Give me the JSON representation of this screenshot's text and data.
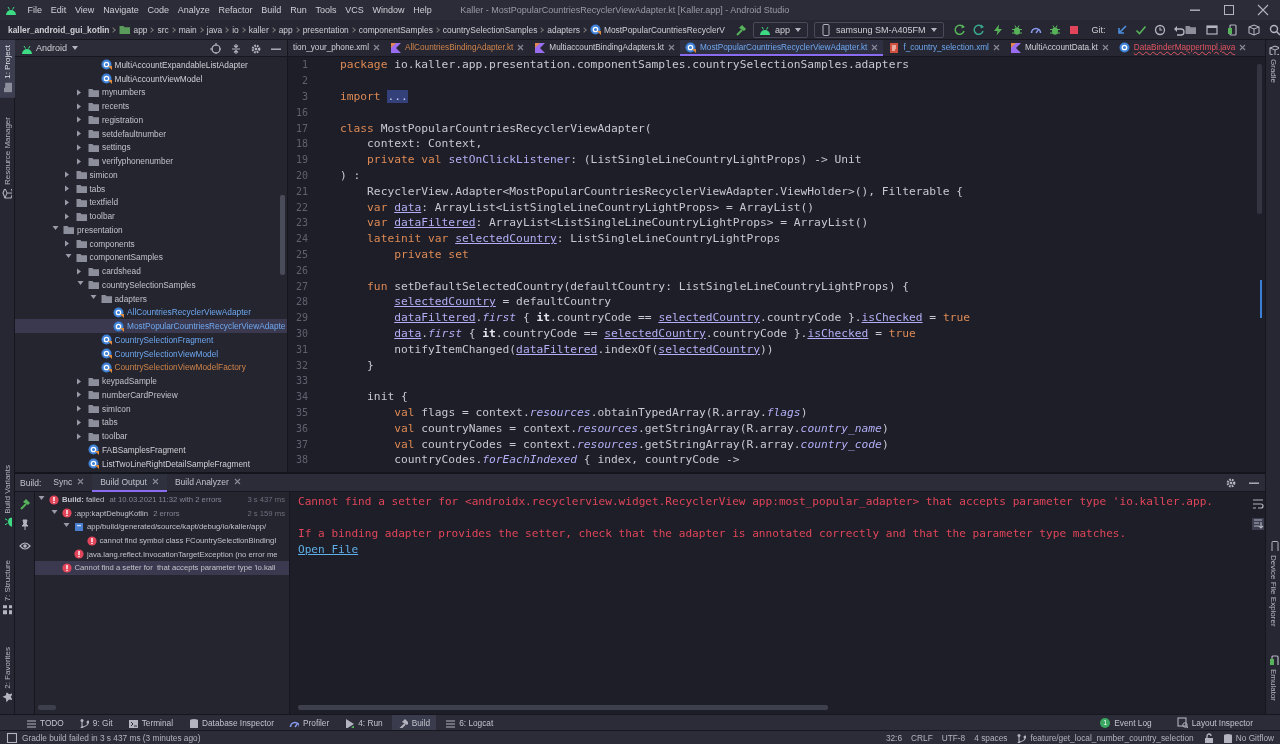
{
  "menu_bar": {
    "items": [
      "File",
      "Edit",
      "View",
      "Navigate",
      "Code",
      "Analyze",
      "Refactor",
      "Build",
      "Run",
      "Tools",
      "VCS",
      "Window",
      "Help"
    ],
    "title": "Kaller - MostPopularCountriesRecyclerViewAdapter.kt [Kaller.app] - Android Studio"
  },
  "nav_bar": {
    "breadcrumbs": [
      {
        "label": "kaller_android_gui_kotlin",
        "kind": "project"
      },
      {
        "label": "app",
        "kind": "module"
      },
      {
        "label": "src",
        "kind": "folder"
      },
      {
        "label": "main",
        "kind": "folder"
      },
      {
        "label": "java",
        "kind": "folder"
      },
      {
        "label": "io",
        "kind": "folder"
      },
      {
        "label": "kaller",
        "kind": "folder"
      },
      {
        "label": "app",
        "kind": "folder"
      },
      {
        "label": "presentation",
        "kind": "folder"
      },
      {
        "label": "componentSamples",
        "kind": "folder"
      },
      {
        "label": "countrySelectionSamples",
        "kind": "folder"
      },
      {
        "label": "adapters",
        "kind": "folder"
      },
      {
        "label": "MostPopularCountriesRecyclerV",
        "kind": "class"
      }
    ],
    "run_config": "app",
    "device": "samsung SM-A405FM",
    "git_label": "Git:"
  },
  "left_strip": {
    "top": [
      {
        "label": "1: Project",
        "selected": true
      },
      {
        "label": "Resource Manager",
        "selected": false
      }
    ],
    "bottom": [
      {
        "label": "Build Variants",
        "selected": false
      },
      {
        "label": "7: Structure",
        "selected": false
      },
      {
        "label": "2: Favorites",
        "selected": false
      }
    ]
  },
  "right_strip": {
    "top": [
      "Gradle"
    ],
    "bottom": [
      "Device File Explorer",
      "Emulator"
    ]
  },
  "project_panel": {
    "view": "Android",
    "tree": [
      {
        "kind": "continuation",
        "children": [
          {
            "kind": "continuation",
            "children": [
              {
                "kind": "continuation",
                "children": [
                  {
                    "kind": "class",
                    "label": "MultiAccountExpandableListAdapter",
                    "modified": false,
                    "unversioned": false,
                    "selected": false
                  },
                  {
                    "kind": "class",
                    "label": "MultiAccountViewModel",
                    "modified": false,
                    "unversioned": false,
                    "selected": false
                  }
                ]
              },
              {
                "kind": "folder",
                "label": "mynumbers",
                "expanded": false,
                "selected": false
              },
              {
                "kind": "folder",
                "label": "recents",
                "expanded": false,
                "selected": false
              },
              {
                "kind": "folder",
                "label": "registration",
                "expanded": false,
                "selected": false
              },
              {
                "kind": "folder",
                "label": "setdefaultnumber",
                "expanded": false,
                "selected": false
              },
              {
                "kind": "folder",
                "label": "settings",
                "expanded": false,
                "selected": false
              },
              {
                "kind": "folder",
                "label": "verifyphonenumber",
                "expanded": false,
                "selected": false
              }
            ]
          },
          {
            "kind": "folder",
            "label": "simicon",
            "expanded": false,
            "selected": false
          },
          {
            "kind": "folder",
            "label": "tabs",
            "expanded": false,
            "selected": false
          },
          {
            "kind": "folder",
            "label": "textfield",
            "expanded": false,
            "selected": false
          },
          {
            "kind": "folder",
            "label": "toolbar",
            "expanded": false,
            "selected": false
          }
        ]
      },
      {
        "kind": "folder",
        "label": "presentation",
        "expanded": true,
        "selected": false,
        "children": [
          {
            "kind": "folder",
            "label": "components",
            "expanded": false,
            "selected": false
          },
          {
            "kind": "folder",
            "label": "componentSamples",
            "expanded": true,
            "selected": false,
            "children": [
              {
                "kind": "folder",
                "label": "cardshead",
                "expanded": false,
                "selected": false
              },
              {
                "kind": "folder",
                "label": "countrySelectionSamples",
                "expanded": true,
                "selected": false,
                "children": [
                  {
                    "kind": "folder",
                    "label": "adapters",
                    "expanded": true,
                    "selected": false,
                    "children": [
                      {
                        "kind": "class",
                        "label": "AllCountriesRecyclerViewAdapter",
                        "modified": true,
                        "unversioned": false,
                        "selected": false
                      },
                      {
                        "kind": "class",
                        "label": "MostPopularCountriesRecyclerViewAdapte",
                        "modified": true,
                        "unversioned": false,
                        "selected": true
                      }
                    ]
                  },
                  {
                    "kind": "class",
                    "label": "CountrySelectionFragment",
                    "modified": true,
                    "unversioned": false,
                    "selected": false
                  },
                  {
                    "kind": "class",
                    "label": "CountrySelectionViewModel",
                    "modified": true,
                    "unversioned": false,
                    "selected": false
                  },
                  {
                    "kind": "class",
                    "label": "CountrySelectionViewModelFactory",
                    "modified": false,
                    "unversioned": true,
                    "selected": false
                  }
                ]
              },
              {
                "kind": "folder",
                "label": "keypadSample",
                "expanded": false,
                "selected": false
              },
              {
                "kind": "folder",
                "label": "numberCardPreview",
                "expanded": false,
                "selected": false
              },
              {
                "kind": "folder",
                "label": "simIcon",
                "expanded": false,
                "selected": false
              },
              {
                "kind": "folder",
                "label": "tabs",
                "expanded": false,
                "selected": false
              },
              {
                "kind": "folder",
                "label": "toolbar",
                "expanded": false,
                "selected": false
              },
              {
                "kind": "class",
                "label": "FABSamplesFragment",
                "modified": false,
                "unversioned": false,
                "selected": false
              },
              {
                "kind": "class",
                "label": "ListTwoLineRightDetailSampleFragment",
                "modified": false,
                "unversioned": false,
                "selected": false
              }
            ]
          }
        ]
      }
    ]
  },
  "editor": {
    "tabs": [
      {
        "label": "tion_your_phone.xml",
        "modified": false,
        "unversioned": false,
        "error": false,
        "selected": false
      },
      {
        "label": "AllCountriesBindingAdapter.kt",
        "kind": "kotlin",
        "modified": false,
        "unversioned": true,
        "error": false,
        "selected": false
      },
      {
        "label": "MultiaccountBindingAdapters.kt",
        "kind": "kotlin",
        "modified": false,
        "unversioned": false,
        "error": false,
        "selected": false
      },
      {
        "label": "MostPopularCountriesRecyclerViewAdapter.kt",
        "kind": "class",
        "modified": true,
        "unversioned": false,
        "error": false,
        "selected": true
      },
      {
        "label": "f_country_selection.xml",
        "kind": "xml",
        "modified": true,
        "unversioned": false,
        "error": false,
        "selected": false
      },
      {
        "label": "MultiAccountData.kt",
        "kind": "kotlin",
        "modified": false,
        "unversioned": false,
        "error": false,
        "selected": false
      },
      {
        "label": "DataBinderMapperImpl.java",
        "kind": "java",
        "modified": false,
        "unversioned": false,
        "error": true,
        "selected": false
      }
    ],
    "lines": [
      {
        "number": "1",
        "segments": [
          {
            "text": "package",
            "kind": "keyword"
          },
          {
            "text": " io.kaller.app.presentation.componentSamples.countrySelectionSamples.adapters",
            "kind": "plain"
          }
        ]
      },
      {
        "number": "2"
      },
      {
        "number": "3",
        "segments": [
          {
            "text": "import ",
            "kind": "keyword"
          },
          {
            "text": "...",
            "kind": "folded"
          }
        ]
      },
      {
        "number": "16"
      },
      {
        "number": "17",
        "segments": [
          {
            "text": "class",
            "kind": "keyword"
          },
          {
            "text": " MostPopularCountriesRecyclerViewAdapter(",
            "kind": "plain"
          }
        ]
      },
      {
        "number": "18",
        "segments": [
          {
            "text": "    context: Context,",
            "kind": "plain"
          }
        ]
      },
      {
        "number": "19",
        "segments": [
          {
            "text": "    private val ",
            "kind": "keyword"
          },
          {
            "text": "setOnClickListener",
            "kind": "property"
          },
          {
            "text": ": (ListSingleLineCountryLightProps) -> Unit",
            "kind": "plain"
          }
        ]
      },
      {
        "number": "20",
        "segments": [
          {
            "text": ") :",
            "kind": "plain"
          }
        ]
      },
      {
        "number": "21",
        "segments": [
          {
            "text": "    RecyclerView.Adapter<MostPopularCountriesRecyclerViewAdapter.ViewHolder>(), Filterable {",
            "kind": "plain"
          }
        ]
      },
      {
        "number": "22",
        "segments": [
          {
            "text": "    var ",
            "kind": "keyword"
          },
          {
            "text": "data",
            "kind": "field"
          },
          {
            "text": ": ArrayList<ListSingleLineCountryLightProps> = ArrayList()",
            "kind": "plain"
          }
        ]
      },
      {
        "number": "23",
        "segments": [
          {
            "text": "    var ",
            "kind": "keyword"
          },
          {
            "text": "dataFiltered",
            "kind": "field"
          },
          {
            "text": ": ArrayList<ListSingleLineCountryLightProps> = ArrayList()",
            "kind": "plain"
          }
        ]
      },
      {
        "number": "24",
        "segments": [
          {
            "text": "    lateinit var ",
            "kind": "keyword"
          },
          {
            "text": "selectedCountry",
            "kind": "field"
          },
          {
            "text": ": ListSingleLineCountryLightProps",
            "kind": "plain"
          }
        ]
      },
      {
        "number": "25",
        "segments": [
          {
            "text": "        private set",
            "kind": "keyword"
          }
        ]
      },
      {
        "number": "26"
      },
      {
        "number": "27",
        "segments": [
          {
            "text": "    fun",
            "kind": "keyword"
          },
          {
            "text": " setDefaultSelectedCountry(defaultCountry: ListSingleLineCountryLightProps) {",
            "kind": "plain"
          }
        ]
      },
      {
        "number": "28",
        "segments": [
          {
            "text": "        selectedCountry",
            "kind": "field"
          },
          {
            "text": " = defaultCountry",
            "kind": "plain"
          }
        ]
      },
      {
        "number": "29",
        "segments": [
          {
            "text": "        dataFiltered",
            "kind": "field"
          },
          {
            "text": ".",
            "kind": "plain"
          },
          {
            "text": "first",
            "kind": "italic"
          },
          {
            "text": " { ",
            "kind": "plain"
          },
          {
            "text": "it",
            "kind": "bold"
          },
          {
            "text": ".countryCode == ",
            "kind": "plain"
          },
          {
            "text": "selectedCountry",
            "kind": "field"
          },
          {
            "text": ".countryCode }.",
            "kind": "plain"
          },
          {
            "text": "isChecked",
            "kind": "field"
          },
          {
            "text": " = ",
            "kind": "plain"
          },
          {
            "text": "true",
            "kind": "keyword"
          }
        ]
      },
      {
        "number": "30",
        "segments": [
          {
            "text": "        data",
            "kind": "field"
          },
          {
            "text": ".",
            "kind": "plain"
          },
          {
            "text": "first",
            "kind": "italic"
          },
          {
            "text": " { ",
            "kind": "plain"
          },
          {
            "text": "it",
            "kind": "bold"
          },
          {
            "text": ".countryCode == ",
            "kind": "plain"
          },
          {
            "text": "selectedCountry",
            "kind": "field"
          },
          {
            "text": ".countryCode }.",
            "kind": "plain"
          },
          {
            "text": "isChecked",
            "kind": "field"
          },
          {
            "text": " = ",
            "kind": "plain"
          },
          {
            "text": "true",
            "kind": "keyword"
          }
        ]
      },
      {
        "number": "31",
        "segments": [
          {
            "text": "        notifyItemChanged(",
            "kind": "plain"
          },
          {
            "text": "dataFiltered",
            "kind": "field"
          },
          {
            "text": ".indexOf(",
            "kind": "plain"
          },
          {
            "text": "selectedCountry",
            "kind": "field"
          },
          {
            "text": "))",
            "kind": "plain"
          }
        ]
      },
      {
        "number": "32",
        "segments": [
          {
            "text": "    }",
            "kind": "plain"
          }
        ]
      },
      {
        "number": "33"
      },
      {
        "number": "34",
        "segments": [
          {
            "text": "    init {",
            "kind": "plain"
          }
        ]
      },
      {
        "number": "35",
        "segments": [
          {
            "text": "        val",
            "kind": "keyword"
          },
          {
            "text": " flags = context.",
            "kind": "plain"
          },
          {
            "text": "resources",
            "kind": "italic"
          },
          {
            "text": ".obtainTypedArray(R.array.",
            "kind": "plain"
          },
          {
            "text": "flags",
            "kind": "italic"
          },
          {
            "text": ")",
            "kind": "plain"
          }
        ]
      },
      {
        "number": "36",
        "segments": [
          {
            "text": "        val",
            "kind": "keyword"
          },
          {
            "text": " countryNames = context.",
            "kind": "plain"
          },
          {
            "text": "resources",
            "kind": "italic"
          },
          {
            "text": ".getStringArray(R.array.",
            "kind": "plain"
          },
          {
            "text": "country_name",
            "kind": "italic"
          },
          {
            "text": ")",
            "kind": "plain"
          }
        ]
      },
      {
        "number": "37",
        "segments": [
          {
            "text": "        val",
            "kind": "keyword"
          },
          {
            "text": " countryCodes = context.",
            "kind": "plain"
          },
          {
            "text": "resources",
            "kind": "italic"
          },
          {
            "text": ".getStringArray(R.array.",
            "kind": "plain"
          },
          {
            "text": "country_code",
            "kind": "italic"
          },
          {
            "text": ")",
            "kind": "plain"
          }
        ]
      },
      {
        "number": "38",
        "segments": [
          {
            "text": "        countryCodes.",
            "kind": "plain"
          },
          {
            "text": "forEachIndexed",
            "kind": "italic"
          },
          {
            "text": " { index, countryCode ->",
            "kind": "plain"
          }
        ]
      }
    ]
  },
  "build_panel": {
    "title": "Build:",
    "tabs": [
      {
        "label": "Sync",
        "selected": false
      },
      {
        "label": "Build Output",
        "selected": true
      },
      {
        "label": "Build Analyzer",
        "selected": false
      }
    ],
    "tree": [
      {
        "kind": "error",
        "label": "**Build:** failed",
        "detail": "at 10.03.2021 11:32 with 2 errors",
        "time": "3 s 437 ms",
        "expanded": true,
        "selected": false,
        "children": [
          {
            "kind": "error",
            "label": ":app:kaptDebugKotlin",
            "detail": "2 errors",
            "time": "2 s 159 ms",
            "expanded": true,
            "selected": false,
            "children": [
              {
                "kind": "file",
                "label": "app/build/generated/source/kapt/debug/io/kaller/app/",
                "expanded": true,
                "selected": false,
                "children": [
                  {
                    "kind": "error",
                    "label": "cannot find symbol class FCountrySelectionBindingI",
                    "selected": false
                  }
                ]
              },
              {
                "kind": "error",
                "label": "java.lang.reflect.InvocationTargetException (no error me",
                "selected": false
              }
            ]
          },
          {
            "kind": "error",
            "label": "Cannot find a setter for  that accepts parameter type 'io.kall",
            "selected": true
          }
        ]
      }
    ],
    "output": {
      "lines": [
        "Cannot find a setter for <androidx.recyclerview.widget.RecyclerView app:most_popular_adapter> that accepts parameter type 'io.kaller.app.",
        "If a binding adapter provides the setter, check that the adapter is annotated correctly and that the parameter type matches."
      ],
      "link": "Open File"
    }
  },
  "tool_windows": [
    {
      "label": "TODO",
      "kind": "list",
      "selected": false
    },
    {
      "label": "9: Git",
      "kind": "branch",
      "selected": false
    },
    {
      "label": "Terminal",
      "kind": "terminal",
      "selected": false
    },
    {
      "label": "Database Inspector",
      "kind": "database",
      "selected": false
    },
    {
      "label": "Profiler",
      "kind": "gauge",
      "selected": false
    },
    {
      "label": "4: Run",
      "kind": "run",
      "selected": false
    },
    {
      "label": "Build",
      "kind": "hammer",
      "selected": true
    },
    {
      "label": "6: Logcat",
      "kind": "list",
      "selected": false
    }
  ],
  "tool_windows_right": [
    {
      "label": "Event Log",
      "badge": "1"
    },
    {
      "label": "Layout Inspector"
    }
  ],
  "status_bar": {
    "message": "Gradle build failed in 3 s 437 ms (3 minutes ago)",
    "items": [
      {
        "text": "32:6"
      },
      {
        "text": "CRLF"
      },
      {
        "text": "UTF-8"
      },
      {
        "text": "4 spaces"
      },
      {
        "text": "feature/get_local_number_country_selection",
        "kind": "branch"
      },
      {
        "text": "No Gitflow",
        "kind": "gitflow"
      }
    ]
  }
}
